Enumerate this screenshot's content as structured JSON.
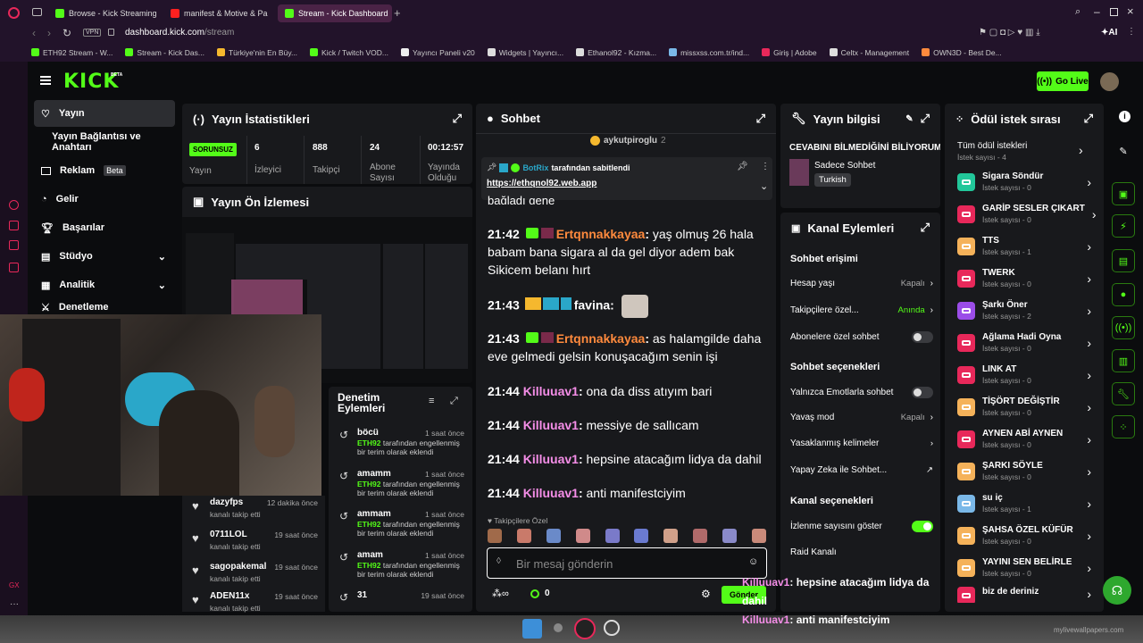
{
  "browser": {
    "tabs": [
      {
        "label": "Browse - Kick Streaming"
      },
      {
        "label": "manifest & Motive & Pa"
      },
      {
        "label": "Stream - Kick Dashboard"
      }
    ],
    "address": {
      "secure_badge": "VPN",
      "url_host": "dashboard.kick.com",
      "url_path": "/stream"
    },
    "toolbar_right": {
      "ai_label": "AI"
    },
    "bookmarks": [
      "ETH92 Stream - W...",
      "Stream - Kick Das...",
      "Türkiye'nin En Büy...",
      "Kick / Twitch VOD...",
      "Yayıncı Paneli v20",
      "Widgets | Yayıncı...",
      "Ethanol92 - Kızma...",
      "missxss.com.tr/ind...",
      "Giriş | Adobe",
      "Celtx - Management",
      "OWN3D - Best De..."
    ],
    "opera_gx_label": "GX"
  },
  "header": {
    "logo": "KICK",
    "logo_sup": "BETA",
    "go_live": "Go Live"
  },
  "sidebar": {
    "items": [
      {
        "label": "Yayın"
      },
      {
        "label": "Yayın Bağlantısı ve Anahtarı"
      },
      {
        "label": "Reklam",
        "badge": "Beta"
      },
      {
        "label": "Gelir"
      },
      {
        "label": "Başarılar"
      },
      {
        "label": "Stüdyo"
      },
      {
        "label": "Analitik"
      },
      {
        "label": "Denetleme"
      }
    ]
  },
  "stats": {
    "title": "Yayın İstatistikleri",
    "status_badge": "SORUNSUZ",
    "status_label": "Yayın",
    "items": [
      {
        "value": "6",
        "label": "İzleyici"
      },
      {
        "value": "888",
        "label": "Takipçi"
      },
      {
        "value": "24",
        "label": "Abone Sayısı"
      },
      {
        "value": "00:12:57",
        "label": "Yayında Olduğu"
      }
    ]
  },
  "preview": {
    "title": "Yayın Ön İzlemesi"
  },
  "followers": {
    "items": [
      {
        "name": "dazyfps",
        "sub": "kanalı takip etti",
        "time": "12 dakika önce"
      },
      {
        "name": "0711LOL",
        "sub": "kanalı takip etti",
        "time": "19 saat önce"
      },
      {
        "name": "sagopakemal",
        "sub": "kanalı takip etti",
        "time": "19 saat önce"
      },
      {
        "name": "ADEN11x",
        "sub": "kanalı takip etti",
        "time": "19 saat önce"
      }
    ]
  },
  "moderation": {
    "title": "Denetim Eylemleri",
    "items": [
      {
        "name": "böcü",
        "time": "1 saat önce",
        "actor": "ETH92",
        "text": "tarafından engellenmiş bir terim olarak eklendi"
      },
      {
        "name": "amamm",
        "time": "1 saat önce",
        "actor": "ETH92",
        "text": "tarafından engellenmiş bir terim olarak eklendi"
      },
      {
        "name": "ammam",
        "time": "1 saat önce",
        "actor": "ETH92",
        "text": "tarafından engellenmiş bir terim olarak eklendi"
      },
      {
        "name": "amam",
        "time": "1 saat önce",
        "actor": "ETH92",
        "text": "tarafından engellenmiş bir terim olarak eklendi"
      },
      {
        "name": "31",
        "time": "19 saat önce",
        "actor": "",
        "text": ""
      }
    ]
  },
  "chat": {
    "title": "Sohbet",
    "top_user": "aykutpiroglu",
    "top_user_count": "2",
    "pinned_by": "BotRix",
    "pinned_text": "tarafından sabitlendi",
    "pinned_link": "https://ethqnol92.web.app",
    "partial_line": "bağladı gene",
    "messages": [
      {
        "time": "21:42",
        "user": "Ertqnnakkayaa",
        "color": "orange",
        "text": "yaş olmuş 26 hala babam bana sigara al da gel diyor adem bak Sikicem belanı hırt"
      },
      {
        "time": "21:43",
        "user": "favina",
        "color": "cyan",
        "text": ""
      },
      {
        "time": "21:43",
        "user": "Ertqnnakkayaa",
        "color": "orange",
        "text": "as halamgilde daha eve gelmedi gelsin konuşacağım senin işi"
      },
      {
        "time": "21:44",
        "user": "Killuuav1",
        "color": "pink",
        "text": "ona da diss atıyım bari"
      },
      {
        "time": "21:44",
        "user": "Killuuav1",
        "color": "pink",
        "text": "messiye de sallıcam"
      },
      {
        "time": "21:44",
        "user": "Killuuav1",
        "color": "pink",
        "text": "hepsine atacağım lidya da dahil"
      },
      {
        "time": "21:44",
        "user": "Killuuav1",
        "color": "pink",
        "text": "anti manifestciyim"
      }
    ],
    "followers_only_label": "Takipçilere Özel",
    "input_placeholder": "Bir mesaj gönderin",
    "points": "0",
    "send": "Gönder"
  },
  "overlay": [
    {
      "user": "Killuuav1",
      "text": ": hepsine atacağım lidya da dahil"
    },
    {
      "user": "Killuuav1",
      "text": ": anti manifestciyim"
    }
  ],
  "stream_info": {
    "title": "Yayın bilgisi",
    "stream_title": "CEVABINI BİLMEDİĞİNİ BİLİYORUM",
    "category": "Sadece Sohbet",
    "language": "Turkish"
  },
  "channel_actions": {
    "title": "Kanal Eylemleri",
    "chat_access": "Sohbet erişimi",
    "rows1": [
      {
        "label": "Hesap yaşı",
        "value": "Kapalı"
      },
      {
        "label": "Takipçilere özel...",
        "value": "Anında"
      },
      {
        "label": "Abonelere özel sohbet",
        "value": ""
      }
    ],
    "chat_options": "Sohbet seçenekleri",
    "rows2": [
      {
        "label": "Yalnızca Emotlarla sohbet",
        "value": ""
      },
      {
        "label": "Yavaş mod",
        "value": "Kapalı"
      },
      {
        "label": "Yasaklanmış kelimeler",
        "value": ""
      },
      {
        "label": "Yapay Zeka ile Sohbet...",
        "value": ""
      }
    ],
    "channel_options": "Kanal seçenekleri",
    "rows3": [
      {
        "label": "İzlenme sayısını göster",
        "value": ""
      },
      {
        "label": "Raid Kanalı",
        "value": ""
      }
    ],
    "accent": "#53fc18"
  },
  "rewards": {
    "title": "Ödül istek sırası",
    "all_label": "Tüm ödül istekleri",
    "all_count": "İstek sayısı - 4",
    "items": [
      {
        "name": "Sigara Söndür",
        "count": "İstek sayısı - 0",
        "color": "#22c79a"
      },
      {
        "name": "GARİP SESLER ÇIKART",
        "count": "İstek sayısı - 0",
        "color": "#e8285a"
      },
      {
        "name": "TTS",
        "count": "İstek sayısı - 1",
        "color": "#f5b25a"
      },
      {
        "name": "TWERK",
        "count": "İstek sayısı - 0",
        "color": "#e8285a"
      },
      {
        "name": "Şarkı Öner",
        "count": "İstek sayısı - 2",
        "color": "#9b4de8"
      },
      {
        "name": "Ağlama Hadi Oyna",
        "count": "İstek sayısı - 0",
        "color": "#e8285a"
      },
      {
        "name": "LINK AT",
        "count": "İstek sayısı - 0",
        "color": "#e8285a"
      },
      {
        "name": "TİŞÖRT DEĞİŞTİR",
        "count": "İstek sayısı - 0",
        "color": "#f5b25a"
      },
      {
        "name": "AYNEN ABİ AYNEN",
        "count": "İstek sayısı - 0",
        "color": "#e8285a"
      },
      {
        "name": "ŞARKI SÖYLE",
        "count": "İstek sayısı - 0",
        "color": "#f5b25a"
      },
      {
        "name": "su iç",
        "count": "İstek sayısı - 1",
        "color": "#7ab8e8"
      },
      {
        "name": "ŞAHSA ÖZEL KÜFÜR",
        "count": "İstek sayısı - 0",
        "color": "#f5b25a"
      },
      {
        "name": "YAYINI SEN BELİRLE",
        "count": "İstek sayısı - 0",
        "color": "#f5b25a"
      },
      {
        "name": "biz de deriniz",
        "count": "",
        "color": "#e8285a"
      }
    ]
  },
  "watermark": "mylivewallpapers.com"
}
